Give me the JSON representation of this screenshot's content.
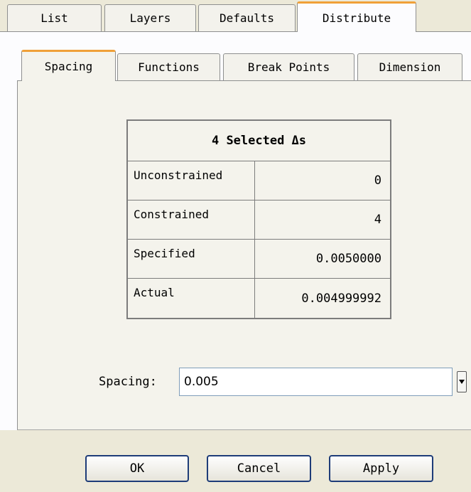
{
  "top_tabs": [
    "List",
    "Layers",
    "Defaults",
    "Distribute"
  ],
  "sub_tabs": [
    "Spacing",
    "Functions",
    "Break Points",
    "Dimension"
  ],
  "table": {
    "header": "4 Selected Δs",
    "rows": [
      {
        "label": "Unconstrained",
        "value": "0"
      },
      {
        "label": "Constrained",
        "value": "4"
      },
      {
        "label": "Specified",
        "value": "0.0050000"
      },
      {
        "label": "Actual",
        "value": "0.004999992"
      }
    ]
  },
  "spacing": {
    "label": "Spacing:",
    "value": "0.005"
  },
  "buttons": {
    "ok": "OK",
    "cancel": "Cancel",
    "apply": "Apply"
  }
}
